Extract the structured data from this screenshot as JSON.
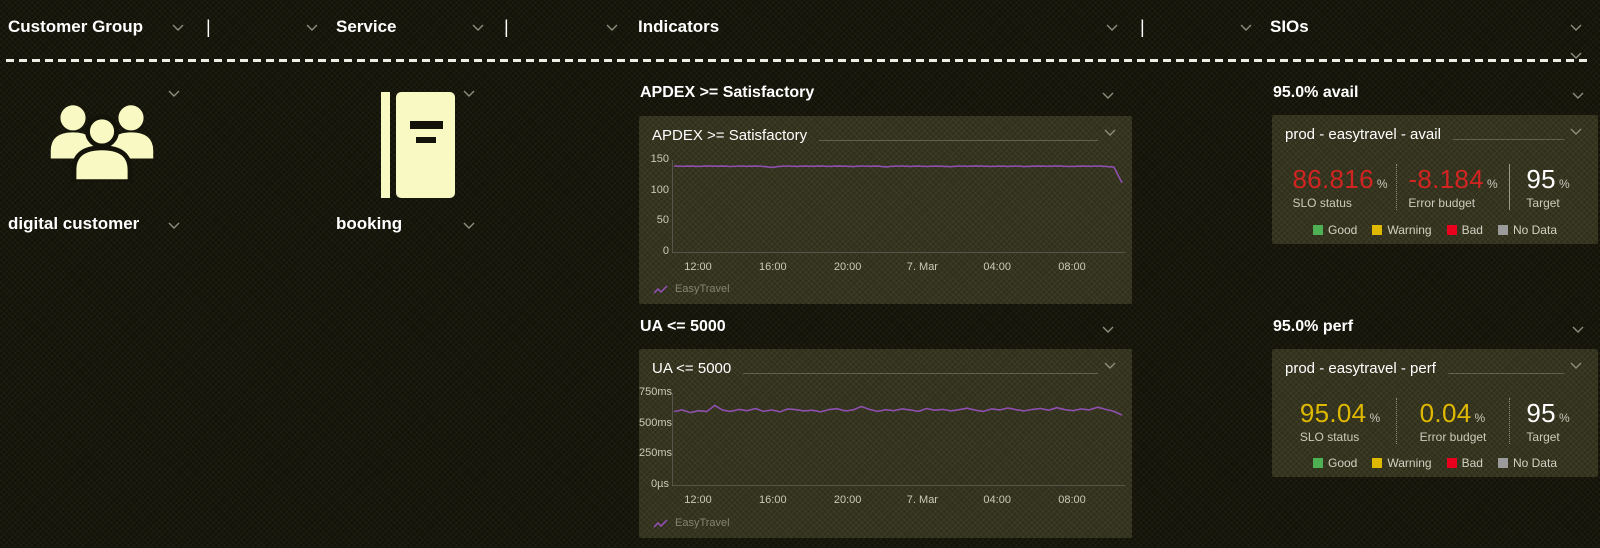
{
  "colors": {
    "accent_icon": "#f9f9c3",
    "line_purple": "#8e4fae",
    "bad_red": "#d22420",
    "warning_yellow": "#dfb800",
    "good_green": "#4db052",
    "nodata_gray": "#9b9b9b",
    "target_white": "#ffffff"
  },
  "topbar": {
    "items": [
      {
        "label": "Customer Group"
      },
      {
        "label": "|"
      },
      {
        "label": "Service"
      },
      {
        "label": "|"
      },
      {
        "label": "Indicators"
      },
      {
        "label": "|"
      },
      {
        "label": "SIOs"
      }
    ]
  },
  "customer_group": {
    "icon": "people-group-icon",
    "label": "digital customer"
  },
  "service": {
    "icon": "book-icon",
    "label": "booking"
  },
  "indicators": {
    "headers": [
      "APDEX >= Satisfactory",
      "UA <= 5000"
    ]
  },
  "chart_data": [
    {
      "type": "line",
      "title": "APDEX >= Satisfactory",
      "x_ticks": [
        "12:00",
        "16:00",
        "20:00",
        "7. Mar",
        "04:00",
        "08:00"
      ],
      "y_ticks": [
        "0",
        "50",
        "100",
        "150"
      ],
      "ylim": [
        0,
        150
      ],
      "legend_position": "bottom-left",
      "series": [
        {
          "name": "EasyTravel",
          "color": "#8e4fae",
          "values": [
            140.2,
            139.8,
            140.1,
            139.5,
            140.3,
            139.9,
            140.0,
            139.4,
            140.2,
            139.7,
            140.1,
            139.6,
            137.9,
            139.8,
            140.2,
            139.6,
            140.0,
            139.8,
            140.3,
            139.5,
            140.1,
            139.9,
            139.3,
            140.2,
            139.7,
            140.0,
            138.8,
            139.9,
            140.2,
            139.6,
            140.1,
            139.4,
            140.0,
            139.8,
            139.1,
            140.2,
            139.7,
            140.3,
            139.9,
            139.5,
            140.1,
            139.6,
            140.2,
            139.3,
            139.9,
            140.0,
            139.7,
            140.3,
            139.8,
            139.5,
            140.1,
            139.8,
            140.2,
            139.6,
            138.5,
            113.0
          ]
        }
      ]
    },
    {
      "type": "line",
      "title": "UA <= 5000",
      "x_ticks": [
        "12:00",
        "16:00",
        "20:00",
        "7. Mar",
        "04:00",
        "08:00"
      ],
      "y_ticks": [
        "0µs",
        "250ms",
        "500ms",
        "750ms"
      ],
      "ylim": [
        0,
        750
      ],
      "legend_position": "bottom-left",
      "series": [
        {
          "name": "EasyTravel",
          "color": "#8e4fae",
          "values": [
            598,
            612,
            590,
            606,
            598,
            648,
            610,
            600,
            616,
            606,
            624,
            600,
            612,
            596,
            620,
            614,
            604,
            610,
            596,
            615,
            622,
            604,
            612,
            640,
            616,
            600,
            614,
            606,
            620,
            612,
            600,
            624,
            610,
            616,
            604,
            614,
            626,
            610,
            600,
            620,
            612,
            628,
            614,
            604,
            616,
            624,
            610,
            630,
            614,
            606,
            620,
            612,
            634,
            616,
            600,
            570
          ]
        }
      ]
    }
  ],
  "slo_tiles": [
    {
      "header": "95.0% avail",
      "title": "prod - easytravel - avail",
      "metrics": [
        {
          "value": "86.816",
          "unit": "%",
          "label": "SLO status",
          "color": "#d22420"
        },
        {
          "value": "-8.184",
          "unit": "%",
          "label": "Error budget",
          "color": "#d22420"
        },
        {
          "value": "95",
          "unit": "%",
          "label": "Target",
          "color": "#ffffff"
        }
      ],
      "legend": [
        {
          "label": "Good",
          "color": "#4db052"
        },
        {
          "label": "Warning",
          "color": "#dfb800"
        },
        {
          "label": "Bad",
          "color": "#e8001c"
        },
        {
          "label": "No Data",
          "color": "#9b9b9b"
        }
      ]
    },
    {
      "header": "95.0% perf",
      "title": "prod - easytravel - perf",
      "metrics": [
        {
          "value": "95.04",
          "unit": "%",
          "label": "SLO status",
          "color": "#dfb800"
        },
        {
          "value": "0.04",
          "unit": "%",
          "label": "Error budget",
          "color": "#dfb800"
        },
        {
          "value": "95",
          "unit": "%",
          "label": "Target",
          "color": "#ffffff"
        }
      ],
      "legend": [
        {
          "label": "Good",
          "color": "#4db052"
        },
        {
          "label": "Warning",
          "color": "#dfb800"
        },
        {
          "label": "Bad",
          "color": "#e8001c"
        },
        {
          "label": "No Data",
          "color": "#9b9b9b"
        }
      ]
    }
  ]
}
